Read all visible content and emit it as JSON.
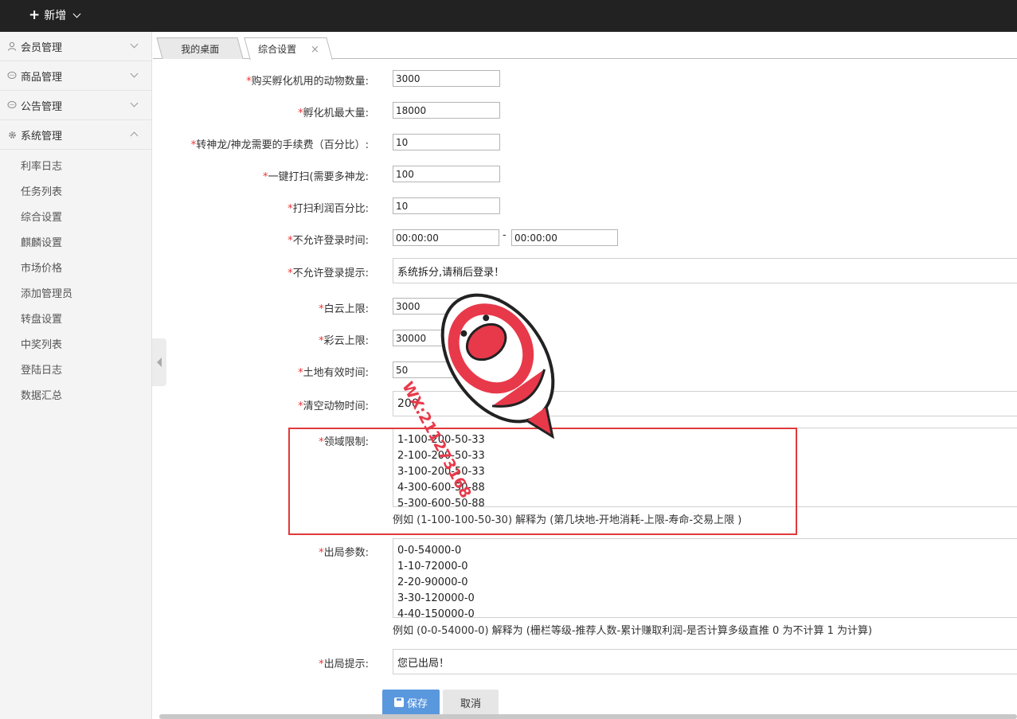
{
  "topbar": {
    "add_label": "新增"
  },
  "sidebar": {
    "groups": [
      {
        "label": "会员管理"
      },
      {
        "label": "商品管理"
      },
      {
        "label": "公告管理"
      },
      {
        "label": "系统管理"
      }
    ],
    "sub_items": [
      "利率日志",
      "任务列表",
      "综合设置",
      "麒麟设置",
      "市场价格",
      "添加管理员",
      "转盘设置",
      "中奖列表",
      "登陆日志",
      "数据汇总"
    ]
  },
  "tabs": [
    {
      "label": "我的桌面"
    },
    {
      "label": "综合设置",
      "close": "×"
    }
  ],
  "form": {
    "required_mark": "*",
    "fields": [
      {
        "label": "购买孵化机用的动物数量:",
        "value": "3000"
      },
      {
        "label": "孵化机最大量:",
        "value": "18000"
      },
      {
        "label": "转神龙/神龙需要的手续费（百分比）:",
        "value": "10"
      },
      {
        "label": "一键打扫(需要多神龙:",
        "value": "100"
      },
      {
        "label": "打扫利润百分比:",
        "value": "10"
      },
      {
        "label": "不允许登录时间:",
        "value_start": "00:00:00",
        "separator": "-",
        "value_end": "00:00:00"
      },
      {
        "label": "不允许登录提示:",
        "value": "系统拆分,请稍后登录！"
      },
      {
        "label": "白云上限:",
        "value": "3000"
      },
      {
        "label": "彩云上限:",
        "value": "30000"
      },
      {
        "label": "土地有效时间:",
        "value": "50"
      },
      {
        "label": "清空动物时间:",
        "value": "200"
      },
      {
        "label": "领域限制:",
        "value": "1-100-200-50-33\n2-100-200-50-33\n3-100-200-50-33\n4-300-600-50-88\n5-300-600-50-88",
        "hint": "例如 (1-100-100-50-30) 解释为 (第几块地-开地消耗-上限-寿命-交易上限 )"
      },
      {
        "label": "出局参数:",
        "value": "0-0-54000-0\n1-10-72000-0\n2-20-90000-0\n3-30-120000-0\n4-40-150000-0",
        "hint": "例如 (0-0-54000-0) 解释为 (栅栏等级-推荐人数-累计赚取利润-是否计算多级直推 0 为不计算 1 为计算)"
      },
      {
        "label": "出局提示:",
        "value": "您已出局！"
      }
    ],
    "save_label": "保存",
    "cancel_label": "取消"
  },
  "watermark": {
    "text": "WX:211273168"
  },
  "colors": {
    "topbar": "#222222",
    "accent": "#5a98de",
    "required": "#ee3333",
    "highlight_box": "#e03a3a"
  }
}
